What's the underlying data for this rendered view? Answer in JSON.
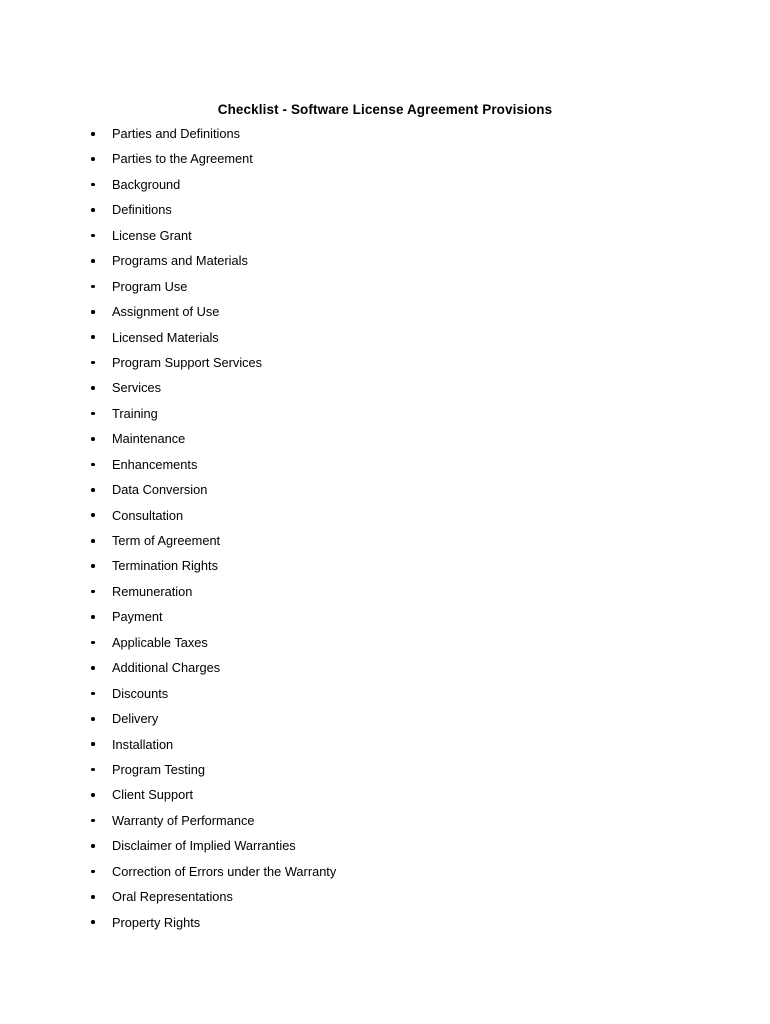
{
  "document": {
    "title": "Checklist - Software License Agreement Provisions",
    "bullet_icon": "bullet-dot-icon",
    "text_color": "#000000",
    "background_color": "#ffffff",
    "items": [
      {
        "label": "Parties and Definitions"
      },
      {
        "label": "Parties to the Agreement"
      },
      {
        "label": "Background"
      },
      {
        "label": "Definitions"
      },
      {
        "label": "License Grant"
      },
      {
        "label": "Programs and Materials"
      },
      {
        "label": "Program Use"
      },
      {
        "label": "Assignment of Use"
      },
      {
        "label": "Licensed Materials"
      },
      {
        "label": "Program Support Services"
      },
      {
        "label": "Services"
      },
      {
        "label": "Training"
      },
      {
        "label": "Maintenance"
      },
      {
        "label": "Enhancements"
      },
      {
        "label": "Data Conversion"
      },
      {
        "label": "Consultation"
      },
      {
        "label": "Term of Agreement"
      },
      {
        "label": "Termination Rights"
      },
      {
        "label": "Remuneration"
      },
      {
        "label": "Payment"
      },
      {
        "label": "Applicable Taxes"
      },
      {
        "label": "Additional Charges"
      },
      {
        "label": "Discounts"
      },
      {
        "label": "Delivery"
      },
      {
        "label": "Installation"
      },
      {
        "label": "Program Testing"
      },
      {
        "label": "Client Support"
      },
      {
        "label": "Warranty of Performance"
      },
      {
        "label": "Disclaimer of Implied Warranties"
      },
      {
        "label": "Correction of Errors under the Warranty"
      },
      {
        "label": "Oral Representations"
      },
      {
        "label": "Property Rights"
      }
    ]
  }
}
